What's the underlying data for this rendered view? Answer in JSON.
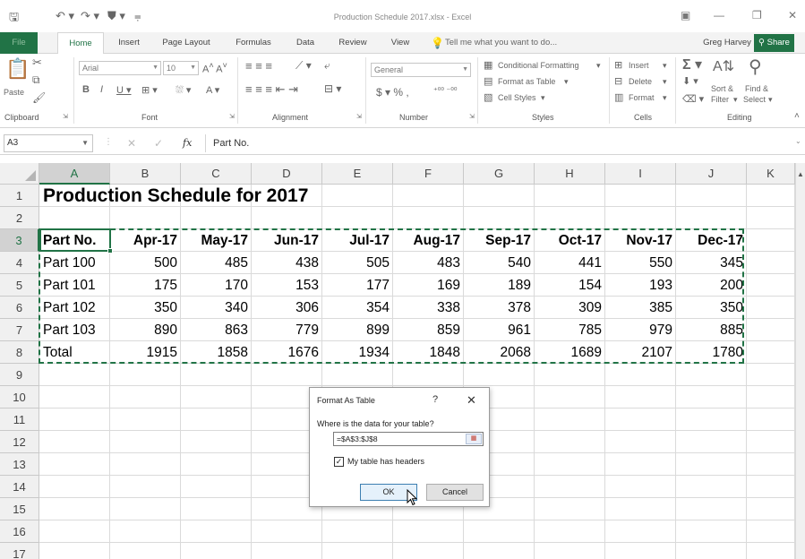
{
  "titlebar": {
    "doc_title": "Production Schedule 2017.xlsx - Excel",
    "save_icon": "save-icon",
    "undo_icon": "undo-icon",
    "redo_icon": "redo-icon"
  },
  "tabs": {
    "file": "File",
    "home": "Home",
    "insert": "Insert",
    "page_layout": "Page Layout",
    "formulas": "Formulas",
    "data": "Data",
    "review": "Review",
    "view": "View",
    "tell_me": "Tell me what you want to do...",
    "user": "Greg Harvey",
    "share": "Share"
  },
  "ribbon": {
    "paste": "Paste",
    "font_name": "Arial",
    "font_size": "10",
    "number_format": "General",
    "conditional_formatting": "Conditional Formatting",
    "format_as_table": "Format as Table",
    "cell_styles": "Cell Styles",
    "insert": "Insert",
    "delete": "Delete",
    "format": "Format",
    "sort_filter_1": "Sort &",
    "sort_filter_2": "Filter",
    "find_select_1": "Find &",
    "find_select_2": "Select",
    "groups": {
      "clipboard": "Clipboard",
      "font": "Font",
      "alignment": "Alignment",
      "number": "Number",
      "styles": "Styles",
      "cells": "Cells",
      "editing": "Editing"
    }
  },
  "formula_bar": {
    "name_box": "A3",
    "fx": "fx",
    "content": "Part No."
  },
  "grid": {
    "columns": [
      "A",
      "B",
      "C",
      "D",
      "E",
      "F",
      "G",
      "H",
      "I",
      "J",
      "K"
    ],
    "rows": [
      "1",
      "2",
      "3",
      "4",
      "5",
      "6",
      "7",
      "8",
      "9",
      "10",
      "11",
      "12",
      "13",
      "14",
      "15",
      "16",
      "17"
    ],
    "title": "Production Schedule for 2017",
    "headers": [
      "Part No.",
      "Apr-17",
      "May-17",
      "Jun-17",
      "Jul-17",
      "Aug-17",
      "Sep-17",
      "Oct-17",
      "Nov-17",
      "Dec-17"
    ],
    "data_rows": [
      [
        "Part 100",
        "500",
        "485",
        "438",
        "505",
        "483",
        "540",
        "441",
        "550",
        "345"
      ],
      [
        "Part 101",
        "175",
        "170",
        "153",
        "177",
        "169",
        "189",
        "154",
        "193",
        "200"
      ],
      [
        "Part 102",
        "350",
        "340",
        "306",
        "354",
        "338",
        "378",
        "309",
        "385",
        "350"
      ],
      [
        "Part 103",
        "890",
        "863",
        "779",
        "899",
        "859",
        "961",
        "785",
        "979",
        "885"
      ],
      [
        "Total",
        "1915",
        "1858",
        "1676",
        "1934",
        "1848",
        "2068",
        "1689",
        "2107",
        "1780"
      ]
    ]
  },
  "dialog": {
    "title": "Format As Table",
    "help": "?",
    "close": "✕",
    "prompt": "Where is the data for your table?",
    "range": "=$A$3:$J$8",
    "checkbox_checked": true,
    "checkbox_label": "My table has headers",
    "ok": "OK",
    "cancel": "Cancel"
  },
  "colors": {
    "excel_green": "#217346",
    "header_bg": "#f0f0f0",
    "gridline": "#dadada"
  }
}
